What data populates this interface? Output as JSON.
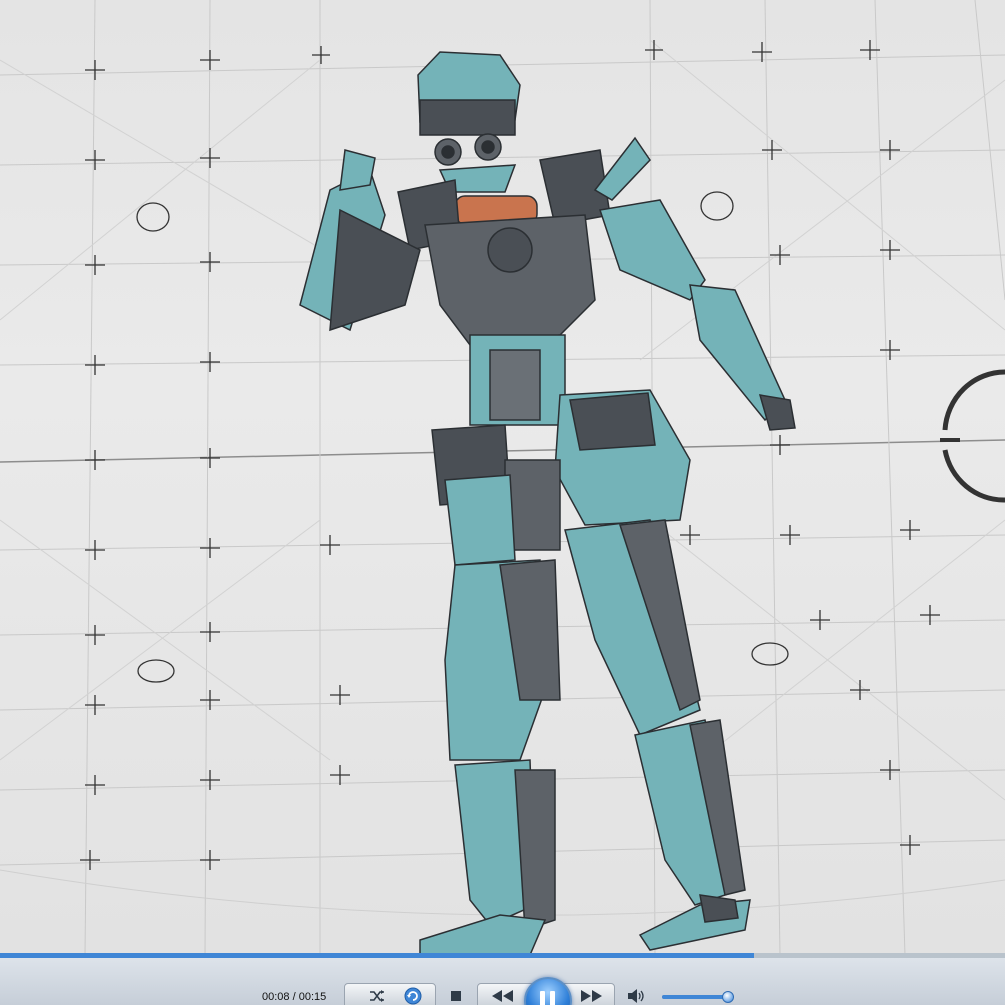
{
  "player": {
    "time": {
      "current": "00:08",
      "separator": " / ",
      "total": "00:15"
    },
    "seek_progress_fraction": 0.75,
    "volume_fraction": 0.9,
    "icons": {
      "shuffle": "shuffle-icon",
      "repeat": "repeat-icon",
      "stop": "stop-icon",
      "previous": "previous-icon",
      "play_pause": "pause-icon",
      "next": "next-icon",
      "volume": "volume-icon"
    },
    "colors": {
      "accent": "#3f86d6",
      "robot_body": "#74b3b8",
      "robot_metal": "#4a4f55",
      "robot_collar": "#c9744e",
      "backdrop": "#e4e4e4"
    }
  }
}
